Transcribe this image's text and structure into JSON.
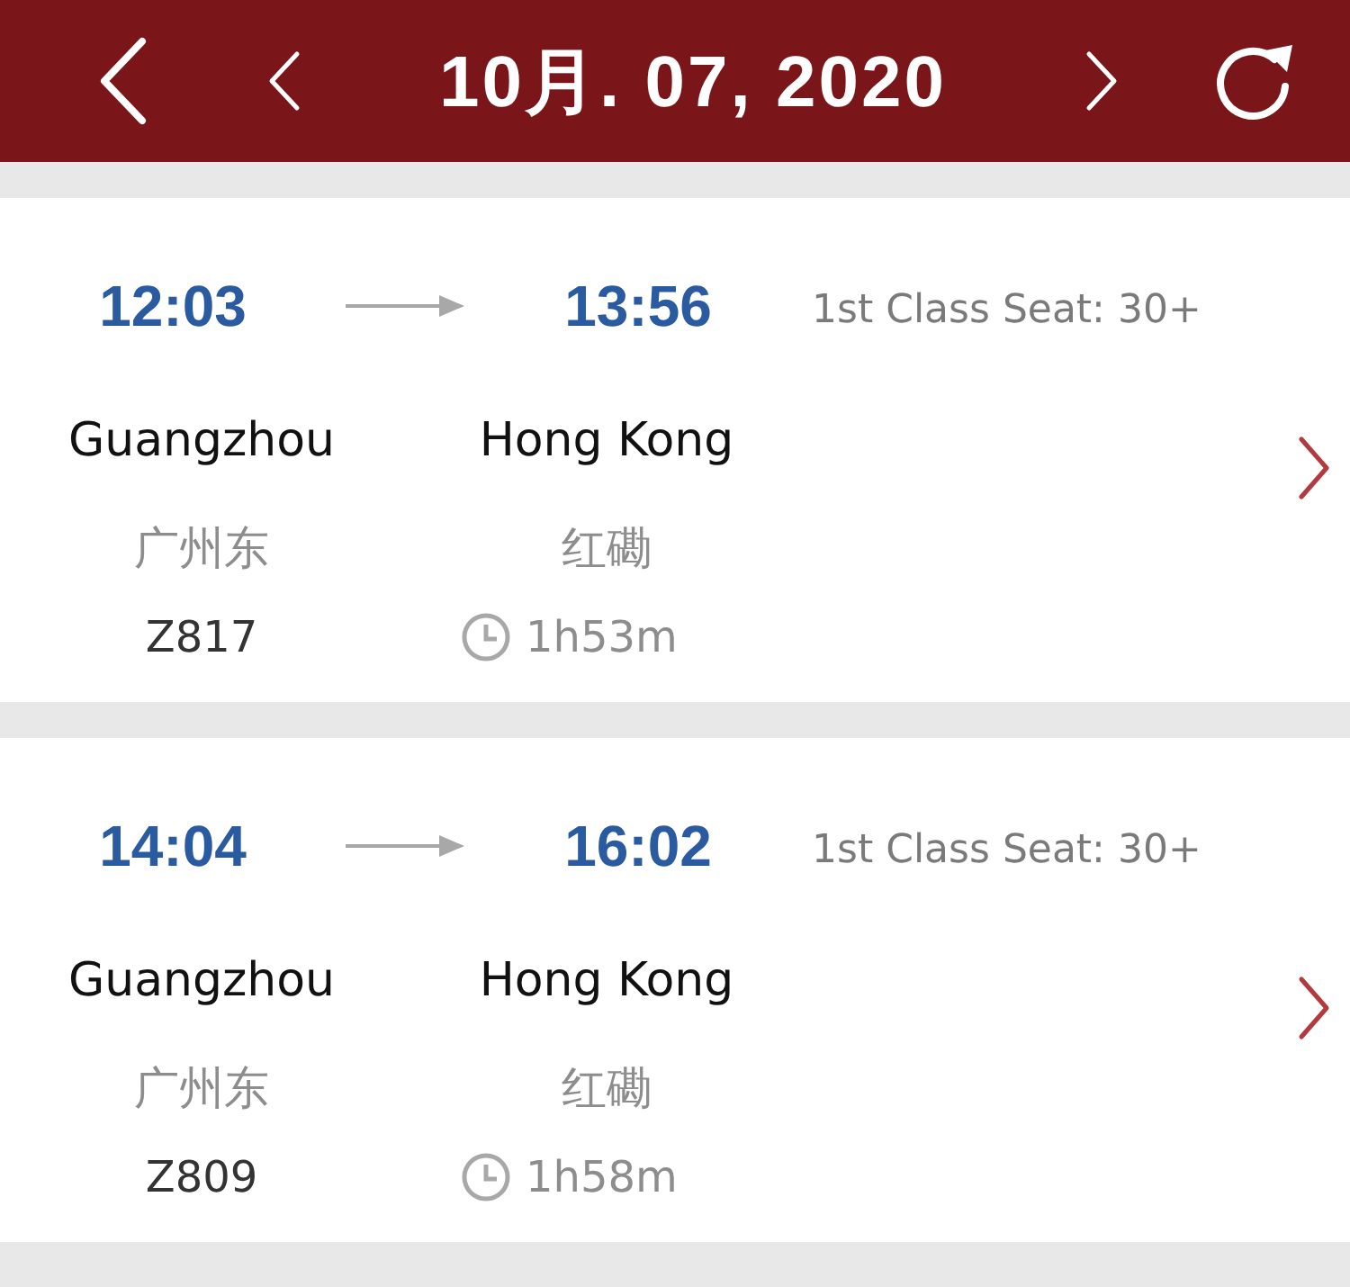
{
  "header": {
    "title": "10月. 07, 2020"
  },
  "trains": [
    {
      "depart_time": "12:03",
      "arrive_time": "13:56",
      "seat": "1st Class Seat: 30+",
      "from_city": "Guangzhou",
      "to_city": "Hong Kong",
      "from_station": "广州东",
      "to_station": "红磡",
      "train_number": "Z817",
      "duration": "1h53m"
    },
    {
      "depart_time": "14:04",
      "arrive_time": "16:02",
      "seat": "1st Class Seat: 30+",
      "from_city": "Guangzhou",
      "to_city": "Hong Kong",
      "from_station": "广州东",
      "to_station": "红磡",
      "train_number": "Z809",
      "duration": "1h58m"
    }
  ]
}
